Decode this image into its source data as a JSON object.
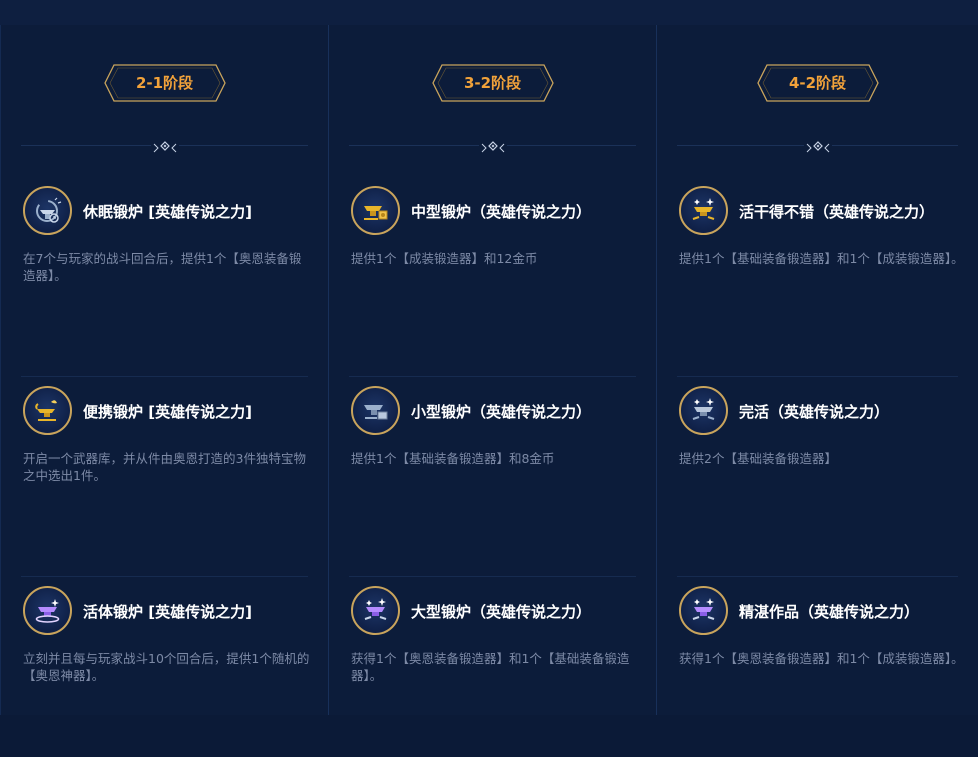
{
  "columns": [
    {
      "stage": "2-1阶段",
      "cards": [
        {
          "title": "休眠锻炉 [英雄传说之力]",
          "desc": "在7个与玩家的战斗回合后，提供1个【奥恩装备锻造器】。",
          "icon": "sleeping-forge-icon"
        },
        {
          "title": "便携锻炉 [英雄传说之力]",
          "desc": "开启一个武器库，并从件由奥恩打造的3件独特宝物之中选出1件。",
          "icon": "portable-forge-icon"
        },
        {
          "title": "活体锻炉 [英雄传说之力]",
          "desc": "立刻并且每与玩家战斗10个回合后，提供1个随机的【奥恩神器】。",
          "icon": "living-forge-icon"
        }
      ]
    },
    {
      "stage": "3-2阶段",
      "cards": [
        {
          "title": "中型锻炉（英雄传说之力）",
          "desc": "提供1个【成装锻造器】和12金币",
          "icon": "medium-forge-icon"
        },
        {
          "title": "小型锻炉（英雄传说之力）",
          "desc": "提供1个【基础装备锻造器】和8金币",
          "icon": "small-forge-icon"
        },
        {
          "title": "大型锻炉（英雄传说之力）",
          "desc": "获得1个【奥恩装备锻造器】和1个【基础装备锻造器】。",
          "icon": "large-forge-icon"
        }
      ]
    },
    {
      "stage": "4-2阶段",
      "cards": [
        {
          "title": "活干得不错（英雄传说之力）",
          "desc": "提供1个【基础装备锻造器】和1个【成装锻造器】。",
          "icon": "good-work-forge-icon"
        },
        {
          "title": "完活（英雄传说之力）",
          "desc": "提供2个【基础装备锻造器】",
          "icon": "job-done-forge-icon"
        },
        {
          "title": "精湛作品（英雄传说之力）",
          "desc": "获得1个【奥恩装备锻造器】和1个【成装锻造器】。",
          "icon": "masterwork-forge-icon"
        }
      ]
    }
  ],
  "colors": {
    "stage_text": "#f1a23a",
    "stage_border": "#c9a45c",
    "icon_gold": "#e8b52a",
    "icon_silver": "#9bb0cc",
    "icon_purple": "#9b6ef5"
  }
}
